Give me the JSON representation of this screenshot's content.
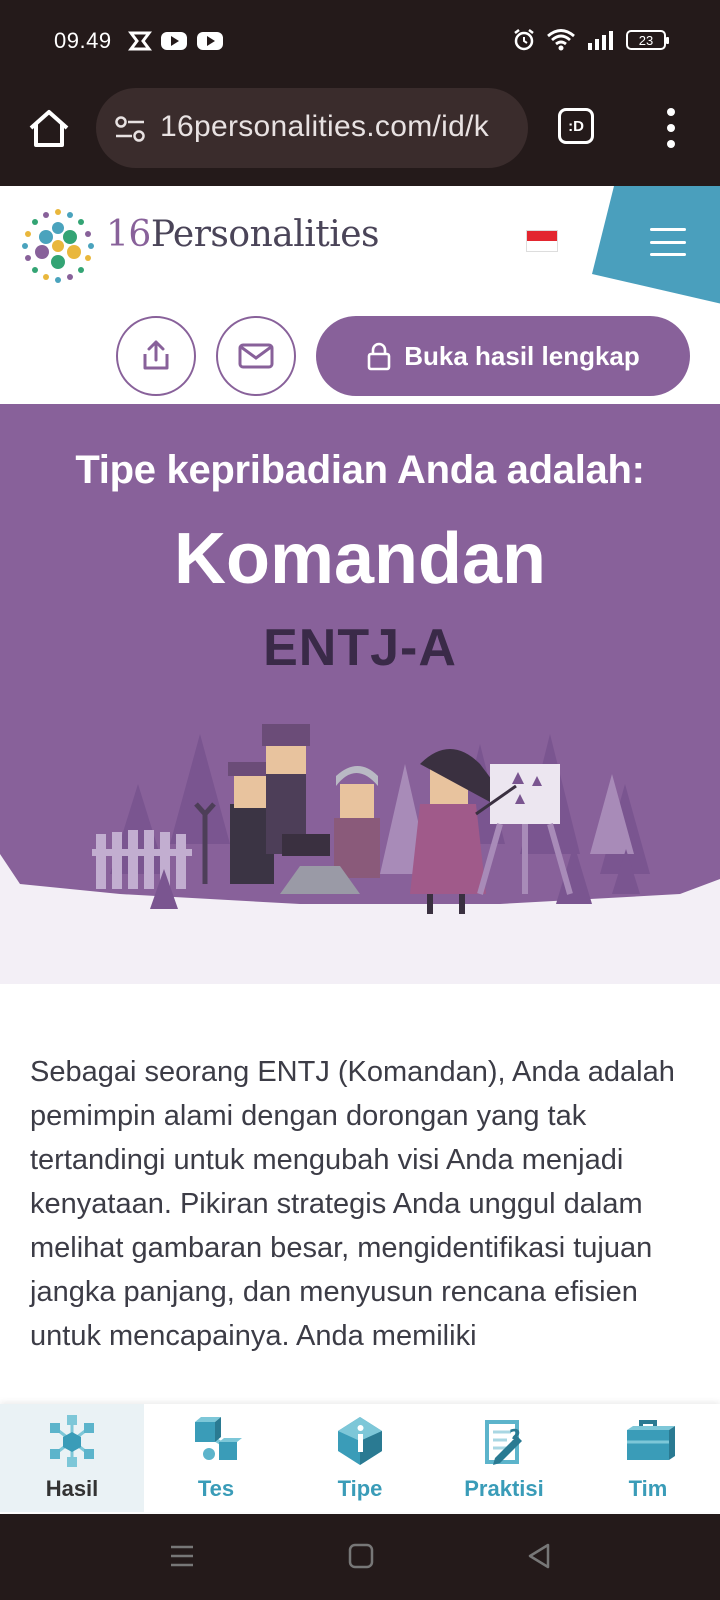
{
  "status_bar": {
    "time": "09.49",
    "battery": "23",
    "left_icons": [
      "z-app-icon",
      "youtube-icon",
      "youtube-icon"
    ],
    "right_icons": [
      "alarm-icon",
      "wifi-icon",
      "signal-icon",
      "battery-icon"
    ]
  },
  "browser": {
    "url": "16personalities.com/id/k",
    "tab_switcher_label": ":D"
  },
  "header": {
    "logo_num": "16",
    "logo_name": "Personalities",
    "accent": "#88619a",
    "menu_color": "#4a9fbd"
  },
  "actions": {
    "unlock_label": "Buka hasil lengkap"
  },
  "hero": {
    "subtitle": "Tipe kepribadian Anda adalah:",
    "title": "Komandan",
    "code": "ENTJ-A"
  },
  "body": {
    "paragraph": "Sebagai seorang ENTJ (Komandan), Anda adalah pemimpin alami dengan dorongan yang tak tertandingi untuk mengubah visi Anda menjadi kenyataan. Pikiran strategis Anda unggul dalam melihat gambaran besar, mengidentifikasi tujuan jangka panjang, dan menyusun rencana efisien untuk mencapainya. Anda memiliki"
  },
  "bottom_nav": {
    "items": [
      {
        "label": "Hasil",
        "icon": "network-cubes-icon"
      },
      {
        "label": "Tes",
        "icon": "connected-cubes-icon"
      },
      {
        "label": "Tipe",
        "icon": "info-gem-icon"
      },
      {
        "label": "Praktisi",
        "icon": "clipboard-question-icon"
      },
      {
        "label": "Tim",
        "icon": "briefcase-icon"
      }
    ]
  }
}
